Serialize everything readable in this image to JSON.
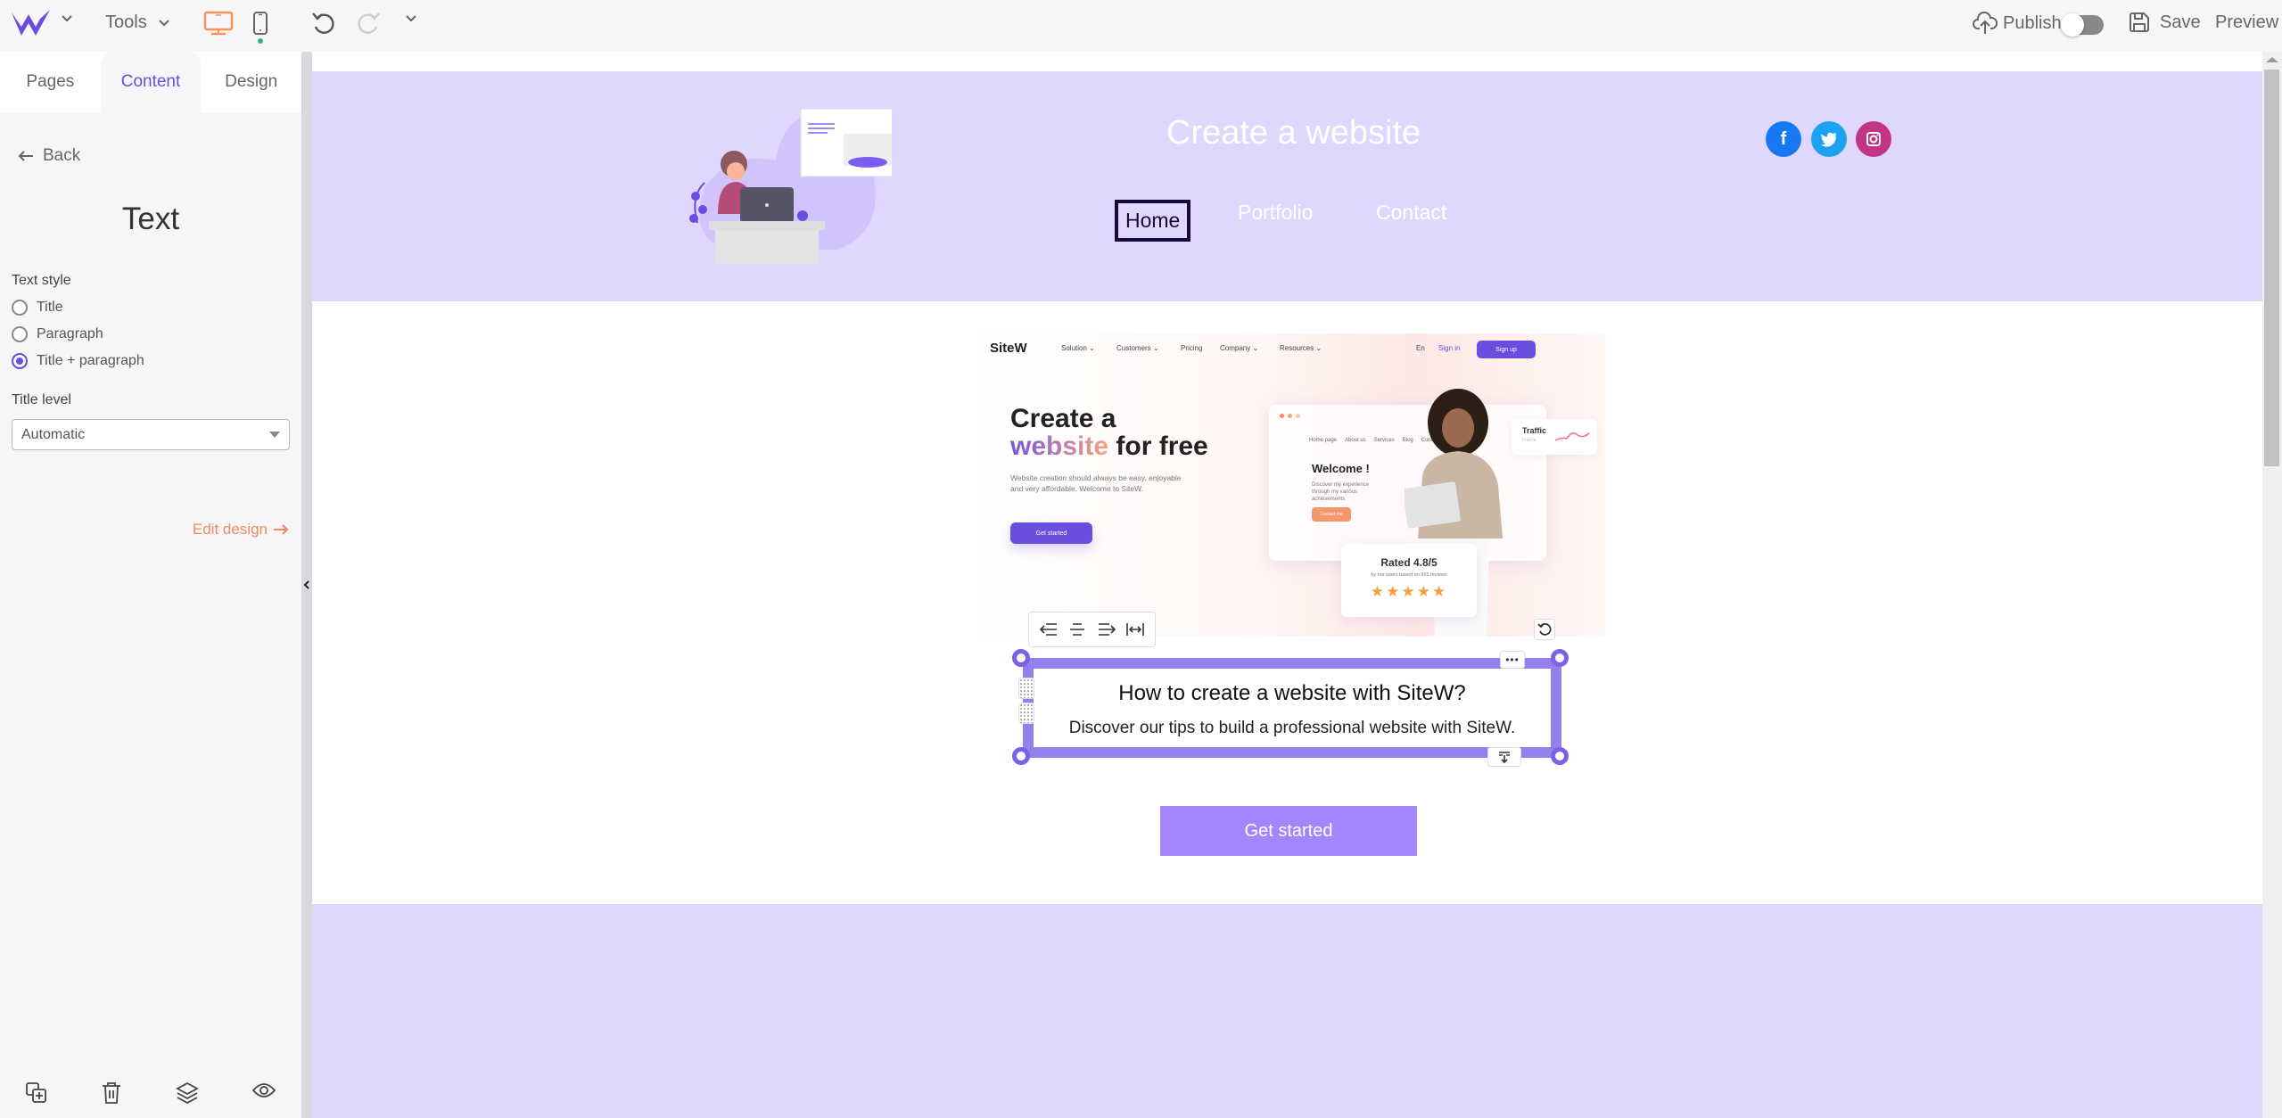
{
  "topbar": {
    "tools_label": "Tools",
    "publish_label": "Publish",
    "save_label": "Save",
    "preview_label": "Preview",
    "publish_toggle_on": false,
    "colors": {
      "logo": "#6a4ee0",
      "device_active": "#f7935a",
      "mobile_dot": "#2db37a"
    }
  },
  "sidebar": {
    "tabs": [
      {
        "label": "Pages",
        "active": false
      },
      {
        "label": "Content",
        "active": true
      },
      {
        "label": "Design",
        "active": false
      }
    ],
    "back_label": "Back",
    "panel_title": "Text",
    "text_style_label": "Text style",
    "text_style_options": [
      {
        "label": "Title",
        "selected": false
      },
      {
        "label": "Paragraph",
        "selected": false
      },
      {
        "label": "Title + paragraph",
        "selected": true
      }
    ],
    "title_level_label": "Title level",
    "title_level_value": "Automatic",
    "edit_design_label": "Edit design",
    "bottom_actions": [
      "duplicate-icon",
      "trash-icon",
      "layers-icon",
      "eye-icon"
    ]
  },
  "site": {
    "title": "Create a website",
    "nav": [
      "Home",
      "Portfolio",
      "Contact"
    ],
    "active_nav": "Home",
    "social": [
      {
        "name": "facebook",
        "glyph": "f",
        "color": "#1877f2"
      },
      {
        "name": "twitter",
        "glyph": "t",
        "color": "#1da1f2"
      },
      {
        "name": "instagram",
        "glyph": "◎",
        "color": "#c13584"
      }
    ],
    "hero_image": {
      "logo": "SiteW",
      "nav": [
        "Solution ⌄",
        "Customers ⌄",
        "Pricing",
        "Company ⌄",
        "Resources ⌄"
      ],
      "lang": "En",
      "sign_in": "Sign in",
      "sign_up": "Sign up",
      "headline_1": "Create a",
      "headline_accent": "website",
      "headline_2": " for free",
      "subtext": "Website creation should always be easy, enjoyable and very affordable. Welcome to SiteW.",
      "cta": "Get started",
      "mock_nav": [
        "Home page",
        "About us",
        "Services",
        "Blog",
        "Contact"
      ],
      "welcome": "Welcome !",
      "welcome_sub": "Discover my experience through my various achievements.",
      "contact_btn": "Contact me",
      "traffic_title": "Traffic",
      "traffic_sub": "France",
      "rating_title": "Rated 4.8/5",
      "rating_sub": "by our users based on 915 reviews",
      "rating_value": 4.8,
      "rating_max": 5
    },
    "text_block": {
      "title": "How to create a website with SiteW?",
      "paragraph": "Discover our tips to build a professional website with SiteW."
    },
    "cta_label": "Get started",
    "colors": {
      "section_bg": "#e0d7fe",
      "cta_bg": "#a385fd",
      "selection": "#9480ec"
    }
  }
}
